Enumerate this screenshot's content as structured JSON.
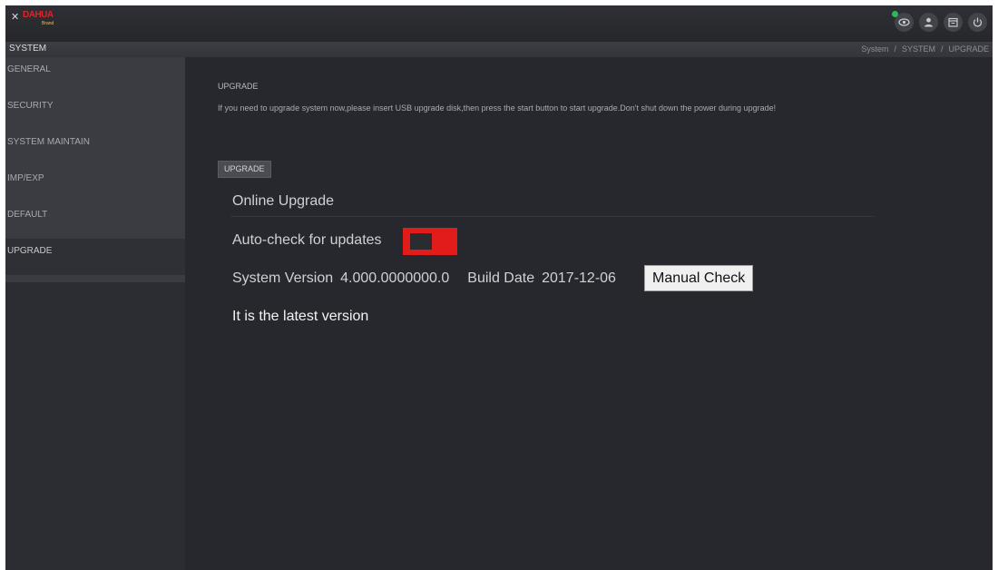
{
  "header": {
    "logo_mark": "✕",
    "logo_text": "DAHUA",
    "logo_sub": "Brand",
    "icons": [
      "live-view-icon",
      "user-icon",
      "calendar-icon",
      "power-icon"
    ],
    "status_dot_color": "#29b85a"
  },
  "crumb": {
    "section": "SYSTEM",
    "path": [
      "System",
      "SYSTEM",
      "UPGRADE"
    ]
  },
  "sidebar": {
    "items": [
      {
        "label": "GENERAL"
      },
      {
        "label": "SECURITY"
      },
      {
        "label": "SYSTEM MAINTAIN"
      },
      {
        "label": "IMP/EXP"
      },
      {
        "label": "DEFAULT"
      },
      {
        "label": "UPGRADE"
      }
    ],
    "active_index": 5
  },
  "main": {
    "title": "UPGRADE",
    "notice": "If you need to upgrade system now,please insert USB upgrade disk,then press the start button to start upgrade.Don't shut down the power during upgrade!",
    "upgrade_button": "UPGRADE",
    "online_title": "Online Upgrade",
    "auto_check_label": "Auto-check for updates",
    "auto_check_enabled": false,
    "toggle_color": "#e21b1b",
    "system_version_label": "System Version",
    "system_version": "4.000.0000000.0",
    "build_date_label": "Build Date",
    "build_date": "2017-12-06",
    "manual_check_button": "Manual Check",
    "status_message": "It is the latest version"
  }
}
